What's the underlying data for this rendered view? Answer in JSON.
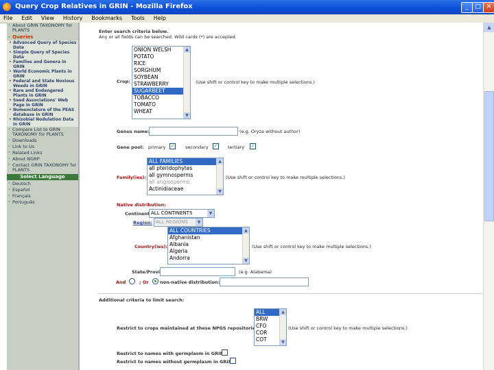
{
  "window": {
    "title": "Query Crop Relatives in GRIN - Mozilla Firefox",
    "controls": {
      "minimize": "_",
      "maximize": "□",
      "close": "✕"
    }
  },
  "menu": [
    "File",
    "Edit",
    "View",
    "History",
    "Bookmarks",
    "Tools",
    "Help"
  ],
  "sidebar": {
    "top_links": [
      "About GRIN TAXONOMY for PLANTS"
    ],
    "queries_label": "Queries",
    "query_items": [
      "Advanced Query of Species Data",
      "Simple Query of Species Data",
      "Families and Genera in GRIN",
      "World Economic Plants in GRIN",
      "Federal and State Noxious Weeds in GRIN",
      "Rare and Endangered Plants in GRIN",
      "Seed Associations' Web Page in GRIN",
      "Nomenclature of the PEAS database in GRIN",
      "Rhizobial Nodulation Data in GRIN"
    ],
    "links": [
      "Compare List to GRIN TAXONOMY for PLANTS",
      "Downloads",
      "Link to Us",
      "Related Links",
      "About NGRP",
      "Contact GRIN TAXONOMY for PLANTS"
    ],
    "language_header": "Select Language",
    "languages": [
      "Deutsch",
      "Español",
      "Français",
      "Português"
    ]
  },
  "form": {
    "intro1": "Enter search criteria below.",
    "intro2": "Any or all fields can be searched.   Wild cards (*) are accepted.",
    "crop": {
      "label": "Crop:",
      "options": [
        "ONION WELSH",
        "POTATO",
        "RICE",
        "SORGHUM",
        "SOYBEAN",
        "STRAWBERRY",
        "SUGARBEET",
        "TOBACCO",
        "TOMATO",
        "WHEAT"
      ],
      "selected": "SUGARBEET",
      "hint": "(Use shift or control key to make multiple selections.)"
    },
    "genus": {
      "label": "Genus name:",
      "value": "",
      "hint": "(e.g. Oryza without author)"
    },
    "genepool": {
      "label": "Gene pool:",
      "primary": "primary",
      "secondary": "secondary",
      "tertiary": "tertiary"
    },
    "family": {
      "label": "Family(ies):",
      "options": [
        "ALL FAMILIES",
        "all pteridophytes",
        "all gymnosperms",
        "all angiosperms",
        "Actinidiaceae"
      ],
      "selected": "ALL FAMILIES",
      "hint": "(Use shift or control key to make multiple selections.)"
    },
    "native": {
      "label": "Native distribution:",
      "continent_label": "Continent:",
      "continent_value": "ALL CONTINENTS",
      "region_label": "Region:",
      "region_value": "ALL REGIONS",
      "country_label": "Country(ies):",
      "countries": [
        "ALL COUNTRIES",
        "Afghanistan",
        "Albania",
        "Algeria",
        "Andorra"
      ],
      "country_selected": "ALL COUNTRIES",
      "country_hint": "(Use shift or control key to make multiple selections.)",
      "state_label": "State/Province:",
      "state_hint": "(e.g. Alabama)",
      "and_label": "And",
      "or_label": "; Or",
      "nonnative_label": "non-native distribution:"
    },
    "additional": {
      "header": "Additional criteria to limit search:",
      "repo_label": "Restrict to crops maintained at these NPGS repositories:",
      "repos": [
        "ALL",
        "BRW",
        "CFO",
        "COR",
        "COT"
      ],
      "repo_selected": "ALL",
      "repo_hint": "(Use shift or control key to make multiple selections.)",
      "germ_label": "Restrict to names with germplasm in GRIN:",
      "nogerm_label": "Restrict to names without germplasm in GRIN:"
    }
  }
}
